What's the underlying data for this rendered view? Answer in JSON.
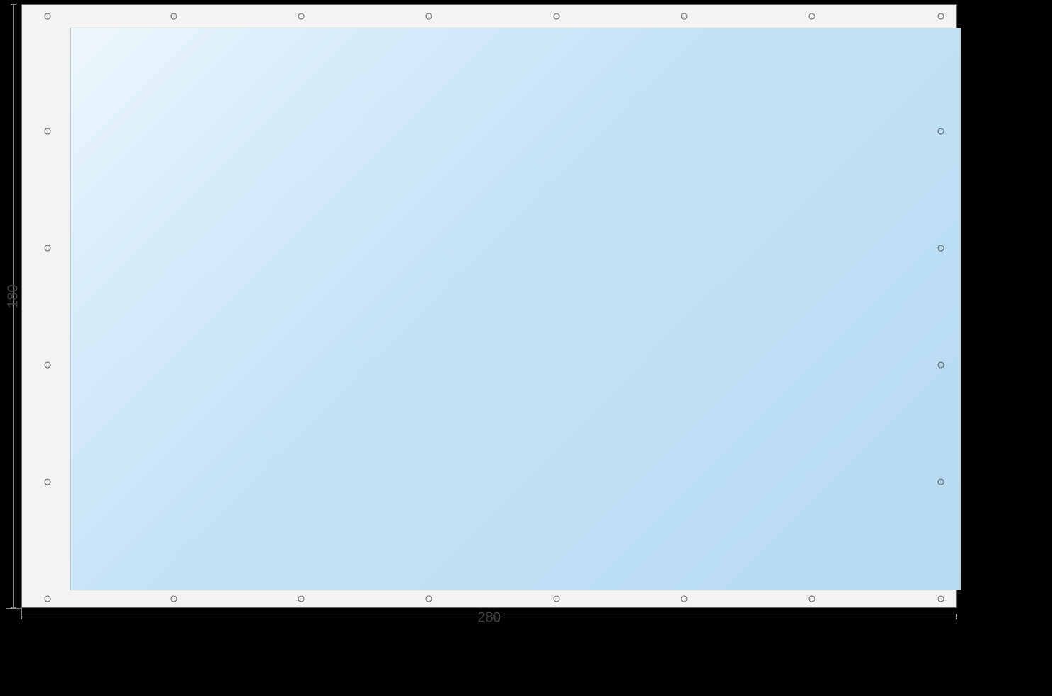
{
  "dimensions": {
    "width_label": "280",
    "height_label": "180"
  },
  "eyelets": {
    "top": [
      "○",
      "○",
      "○",
      "○",
      "○",
      "○",
      "○",
      "○"
    ],
    "bottom": [
      "○",
      "○",
      "○",
      "○",
      "○",
      "○",
      "○",
      "○"
    ],
    "left": [
      "○",
      "○",
      "○",
      "○"
    ],
    "right": [
      "○",
      "○",
      "○",
      "○"
    ]
  },
  "colors": {
    "tarp_gradient_start": "#eef7fc",
    "tarp_gradient_end": "#b7daf2",
    "frame_bg": "#f3f3f3",
    "page_bg": "#000000"
  }
}
